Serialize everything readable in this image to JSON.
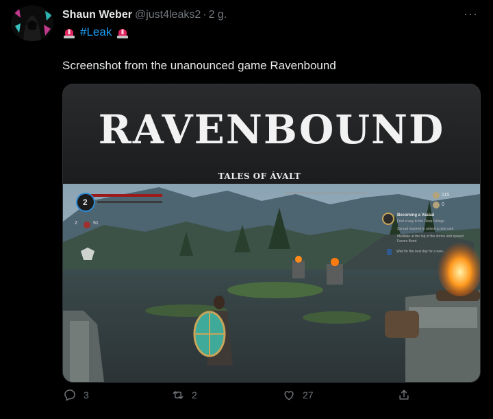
{
  "author": {
    "name": "Shaun Weber",
    "handle": "@just4leaks2",
    "separator": "·",
    "time": "2 g."
  },
  "menu": {
    "more_icon": "more-horizontal-icon",
    "label": "···"
  },
  "hashtag_line": {
    "hashtag": "#Leak",
    "icon": "police-siren-icon"
  },
  "text": "Screenshot from the unanounced game Ravenbound",
  "media": {
    "title": "RAVENBOUND",
    "subtitle": "TALES OF ÁVALT",
    "hud": {
      "level": "2",
      "left_count": "2",
      "right_count": "51",
      "currency": "115",
      "currency_secondary": "0",
      "quest_title": "Becoming a Vassal",
      "quest_line1": "Find a way to the Deep Refuge",
      "quest_line2": "Spread inspired to unlock a new card",
      "quest_line3": "Meditate at the top of the shrine and spread Favors Bond",
      "quest_line4": "Wait for the next day for a new..."
    }
  },
  "actions": {
    "reply": {
      "icon": "reply-icon",
      "count": "3"
    },
    "retweet": {
      "icon": "retweet-icon",
      "count": "2"
    },
    "like": {
      "icon": "heart-icon",
      "count": "27"
    },
    "share": {
      "icon": "share-icon"
    }
  },
  "colors": {
    "accent": "#1d9bf0",
    "muted": "#71767b",
    "background": "#000000"
  }
}
